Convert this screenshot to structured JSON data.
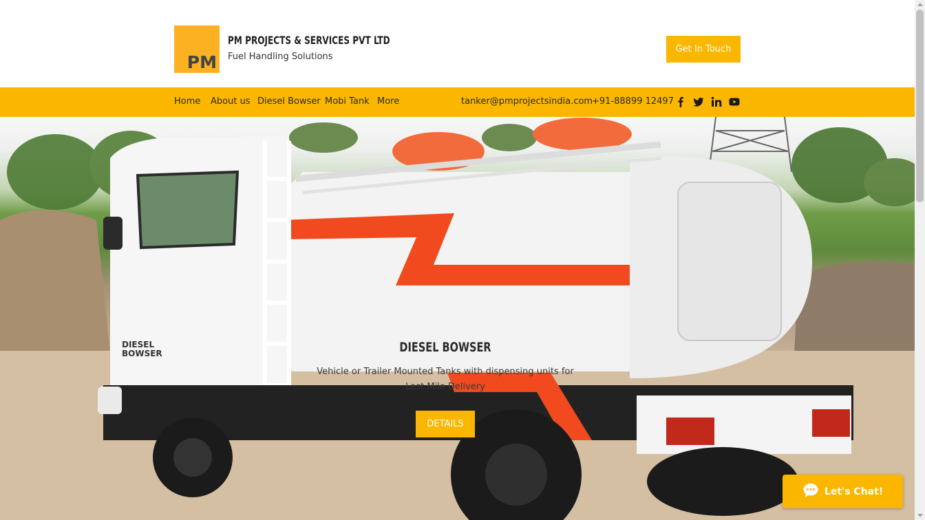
{
  "header": {
    "logo_text": "PM",
    "company_name": "PM PROJECTS & SERVICES PVT LTD",
    "tagline": "Fuel Handling Solutions",
    "cta_label": "Get In Touch"
  },
  "nav": {
    "items": [
      {
        "label": "Home"
      },
      {
        "label": "About us"
      },
      {
        "label": "Diesel Bowser"
      },
      {
        "label": "Mobi Tank"
      },
      {
        "label": "More"
      }
    ],
    "email": "tanker@pmprojectsindia.com",
    "phone": "+91-88899 12497",
    "social": [
      "facebook-icon",
      "twitter-icon",
      "linkedin-icon",
      "youtube-icon"
    ]
  },
  "hero": {
    "title": "DIESEL BOWSER",
    "subtitle_line1": "Vehicle or Trailer Mounted Tanks with dispensing units for",
    "subtitle_line2": "Last Mile Delivery",
    "button_label": "DETAILS",
    "truck_door_text_1": "DIESEL",
    "truck_door_text_2": "BOWSER"
  },
  "chat": {
    "label": "Let's Chat!"
  },
  "colors": {
    "brand_yellow": "#fbb600",
    "logo_orange": "#fbb122",
    "tank_stripe": "#f04a1e"
  }
}
